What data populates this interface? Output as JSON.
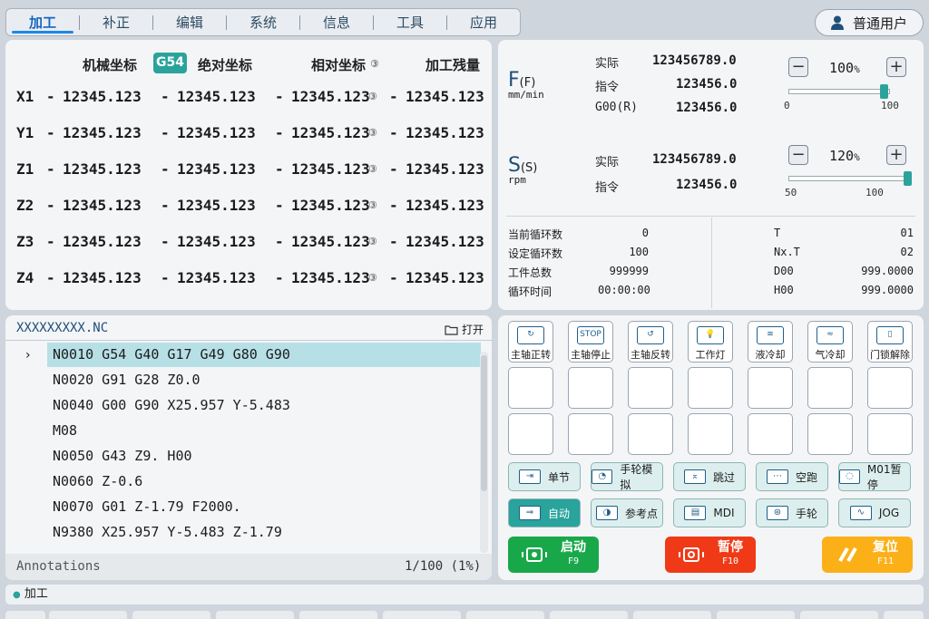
{
  "tabs": [
    "加工",
    "补正",
    "编辑",
    "系统",
    "信息",
    "工具",
    "应用"
  ],
  "user": "普通用户",
  "coords": {
    "h_machine": "机械坐标",
    "wcs": "G54",
    "h_abs": "绝对坐标",
    "h_rel": "相对坐标",
    "h_remain": "加工残量",
    "rows": [
      {
        "axis": "X1",
        "machine": "12345.123",
        "abs": "12345.123",
        "rel": "12345.123",
        "remain": "12345.123"
      },
      {
        "axis": "Y1",
        "machine": "12345.123",
        "abs": "12345.123",
        "rel": "12345.123",
        "remain": "12345.123"
      },
      {
        "axis": "Z1",
        "machine": "12345.123",
        "abs": "12345.123",
        "rel": "12345.123",
        "remain": "12345.123"
      },
      {
        "axis": "Z2",
        "machine": "12345.123",
        "abs": "12345.123",
        "rel": "12345.123",
        "remain": "12345.123"
      },
      {
        "axis": "Z3",
        "machine": "12345.123",
        "abs": "12345.123",
        "rel": "12345.123",
        "remain": "12345.123"
      },
      {
        "axis": "Z4",
        "machine": "12345.123",
        "abs": "12345.123",
        "rel": "12345.123",
        "remain": "12345.123"
      }
    ]
  },
  "feed": {
    "letter": "F",
    "sub": "(F)",
    "unit": "mm/min",
    "actual_l": "实际",
    "actual": "123456789.0",
    "cmd_l": "指令",
    "cmd": "123456.0",
    "g00_l": "G00(R)",
    "g00": "123456.0",
    "ovr": "100",
    "pct": "%",
    "tick_lo": "0",
    "tick_hi": "100",
    "level": 1.0
  },
  "spindle": {
    "letter": "S",
    "sub": "(S)",
    "unit": "rpm",
    "actual_l": "实际",
    "actual": "123456789.0",
    "cmd_l": "指令",
    "cmd": "123456.0",
    "ovr": "120",
    "pct": "%",
    "tick_lo": "50",
    "tick_hi": "100",
    "level": 1.2
  },
  "stats": {
    "cur_cycle_l": "当前循环数",
    "cur_cycle": "0",
    "set_cycle_l": "设定循环数",
    "set_cycle": "100",
    "total_l": "工件总数",
    "total": "999999",
    "time_l": "循环时间",
    "time": "00:00:00",
    "t_l": "T",
    "t": "01",
    "nxt_l": "Nx.T",
    "nxt": "02",
    "d_l": "D00",
    "d": "999.0000",
    "h_l": "H00",
    "h": "999.0000"
  },
  "program": {
    "file": "XXXXXXXXX.NC",
    "open": "打开",
    "lines": [
      "N0010 G54 G40 G17 G49 G80 G90",
      "N0020 G91 G28 Z0.0",
      "N0040 G00 G90 X25.957 Y-5.483",
      "M08",
      "N0050 G43 Z9. H00",
      "N0060 Z-0.6",
      "N0070 G01 Z-1.79 F2000.",
      "N9380 X25.957 Y-5.483 Z-1.79"
    ],
    "annotations": "Annotations",
    "page": "1/100 (1%)"
  },
  "soft_buttons": [
    "主轴正转",
    "主轴停止",
    "主轴反转",
    "工作灯",
    "液冷却",
    "气冷却",
    "门锁解除"
  ],
  "modes1": [
    "单节",
    "手轮模拟",
    "跳过",
    "空跑",
    "M01暂停"
  ],
  "modes2": [
    "自动",
    "参考点",
    "MDI",
    "手轮",
    "JOG"
  ],
  "big": {
    "start": "启动",
    "start_k": "F9",
    "pause": "暂停",
    "pause_k": "F10",
    "reset": "复位",
    "reset_k": "F11"
  },
  "status": "加工",
  "colors": {
    "accent": "#1e88e5",
    "teal": "#2aa39c",
    "start": "#18a84a",
    "pause": "#f03a17",
    "reset": "#fbb018"
  }
}
